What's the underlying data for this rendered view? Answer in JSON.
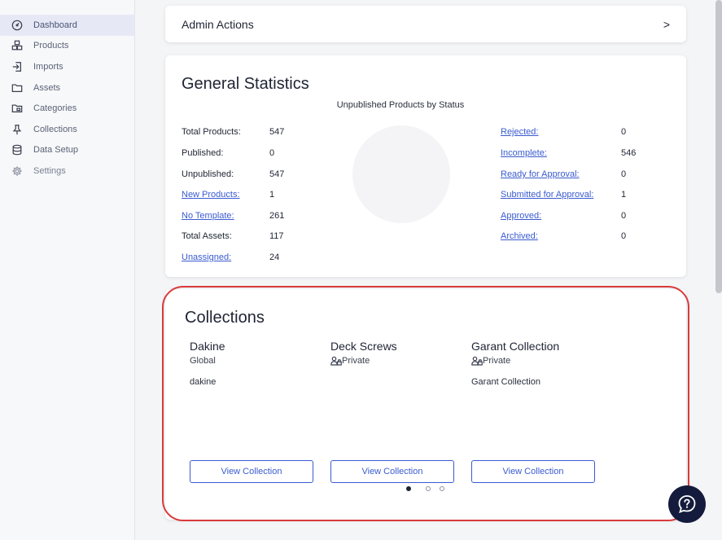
{
  "sidebar": {
    "items": [
      {
        "label": "Dashboard",
        "icon": "dashboard-icon",
        "active": true
      },
      {
        "label": "Products",
        "icon": "products-icon"
      },
      {
        "label": "Imports",
        "icon": "imports-icon"
      },
      {
        "label": "Assets",
        "icon": "folder-icon"
      },
      {
        "label": "Categories",
        "icon": "categories-icon"
      },
      {
        "label": "Collections",
        "icon": "pin-icon"
      },
      {
        "label": "Data Setup",
        "icon": "database-icon"
      },
      {
        "label": "Settings",
        "icon": "gear-icon"
      }
    ]
  },
  "admin": {
    "title": "Admin Actions",
    "chevron": ">"
  },
  "stats": {
    "title": "General Statistics",
    "chart_title": "Unpublished Products by Status",
    "left": [
      {
        "label": "Total Products:",
        "value": "547",
        "link": false
      },
      {
        "label": "Published:",
        "value": "0",
        "link": false
      },
      {
        "label": "Unpublished:",
        "value": "547",
        "link": false
      },
      {
        "label": "New Products:",
        "value": "1",
        "link": true
      },
      {
        "label": "No Template:",
        "value": "261",
        "link": true
      },
      {
        "label": "Total Assets:",
        "value": "117",
        "link": false
      },
      {
        "label": "Unassigned:",
        "value": "24",
        "link": true
      }
    ],
    "right": [
      {
        "label": "Rejected:",
        "value": "0"
      },
      {
        "label": "Incomplete:",
        "value": "546"
      },
      {
        "label": "Ready for Approval:",
        "value": "0"
      },
      {
        "label": "Submitted for Approval:",
        "value": "1"
      },
      {
        "label": "Approved:",
        "value": "0"
      },
      {
        "label": "Archived:",
        "value": "0"
      }
    ]
  },
  "collections": {
    "title": "Collections",
    "items": [
      {
        "name": "Dakine",
        "visibility": "Global",
        "private": false,
        "description": "dakine",
        "button": "View Collection"
      },
      {
        "name": "Deck Screws",
        "visibility": "Private",
        "private": true,
        "description": "",
        "button": "View Collection"
      },
      {
        "name": "Garant Collection",
        "visibility": "Private",
        "private": true,
        "description": "Garant Collection",
        "button": "View Collection"
      }
    ],
    "pagination": {
      "current": 1,
      "total": 3
    }
  },
  "colors": {
    "accent": "#3a5bd0",
    "highlight": "#d93a3a",
    "help_bg": "#141b3c"
  }
}
